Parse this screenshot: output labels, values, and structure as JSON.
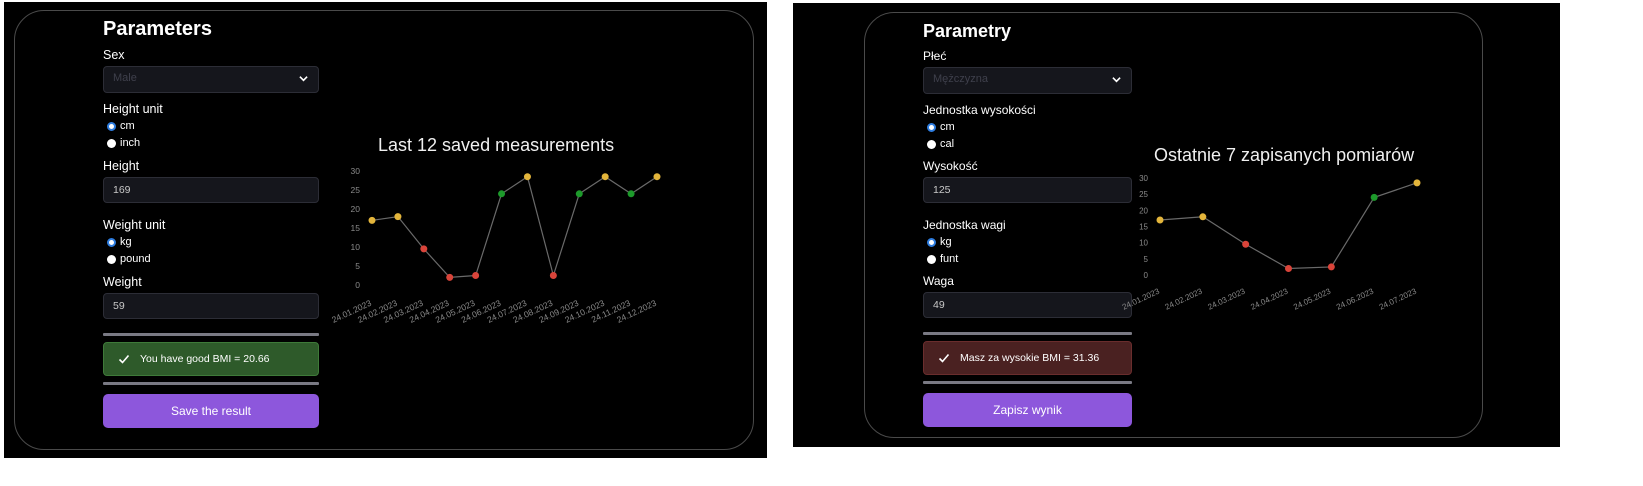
{
  "panels": [
    {
      "title": "Parameters",
      "sex": {
        "label": "Sex",
        "value": "Male"
      },
      "height_unit": {
        "label": "Height unit",
        "options": [
          "cm",
          "inch"
        ],
        "selected": 0
      },
      "height": {
        "label": "Height",
        "value": "169"
      },
      "weight_unit": {
        "label": "Weight unit",
        "options": [
          "kg",
          "pound"
        ],
        "selected": 0
      },
      "weight": {
        "label": "Weight",
        "value": "59"
      },
      "result": {
        "text": "You have good BMI = 20.66",
        "status": "good"
      },
      "save_label": "Save the result",
      "chart_title": "Last 12 saved measurements"
    },
    {
      "title": "Parametry",
      "sex": {
        "label": "Płeć",
        "value": "Mężczyzna"
      },
      "height_unit": {
        "label": "Jednostka wysokości",
        "options": [
          "cm",
          "cal"
        ],
        "selected": 0
      },
      "height": {
        "label": "Wysokość",
        "value": "125"
      },
      "weight_unit": {
        "label": "Jednostka wagi",
        "options": [
          "kg",
          "funt"
        ],
        "selected": 0
      },
      "weight": {
        "label": "Waga",
        "value": "49"
      },
      "result": {
        "text": "Masz za wysokie BMI = 31.36",
        "status": "bad"
      },
      "save_label": "Zapisz wynik",
      "chart_title": "Ostatnie 7 zapisanych pomiarów"
    }
  ],
  "colors": {
    "accent": "#8d57dc",
    "good": "#2e5a2a",
    "bad": "#4a2121",
    "point_green": "#1d9a2b",
    "point_yellow": "#e3b53b",
    "point_red": "#d9443a"
  },
  "chart_data": [
    {
      "type": "line",
      "title": "Last 12 saved measurements",
      "x": [
        "24.01.2023",
        "24.02.2023",
        "24.03.2023",
        "24.04.2023",
        "24.05.2023",
        "24.06.2023",
        "24.07.2023",
        "24.08.2023",
        "24.09.2023",
        "24.10.2023",
        "24.11.2023",
        "24.12.2023"
      ],
      "values": [
        17,
        18,
        9.5,
        2,
        2.5,
        24,
        28.5,
        2.5,
        24,
        28.5,
        24,
        28.5
      ],
      "point_status": [
        "yellow",
        "yellow",
        "red",
        "red",
        "red",
        "green",
        "yellow",
        "red",
        "green",
        "yellow",
        "green",
        "yellow"
      ],
      "yticks": [
        0,
        5,
        10,
        15,
        20,
        25,
        30
      ],
      "ylim": [
        0,
        30
      ],
      "grid": false,
      "legend": "none"
    },
    {
      "type": "line",
      "title": "Ostatnie 7 zapisanych pomiarów",
      "x": [
        "24.01.2023",
        "24.02.2023",
        "24.03.2023",
        "24.04.2023",
        "24.05.2023",
        "24.06.2023",
        "24.07.2023"
      ],
      "values": [
        17,
        18,
        9.5,
        2,
        2.5,
        24,
        28.5
      ],
      "point_status": [
        "yellow",
        "yellow",
        "red",
        "red",
        "red",
        "green",
        "yellow"
      ],
      "yticks": [
        0,
        5,
        10,
        15,
        20,
        25,
        30
      ],
      "ylim": [
        0,
        30
      ],
      "grid": false,
      "legend": "none"
    }
  ]
}
